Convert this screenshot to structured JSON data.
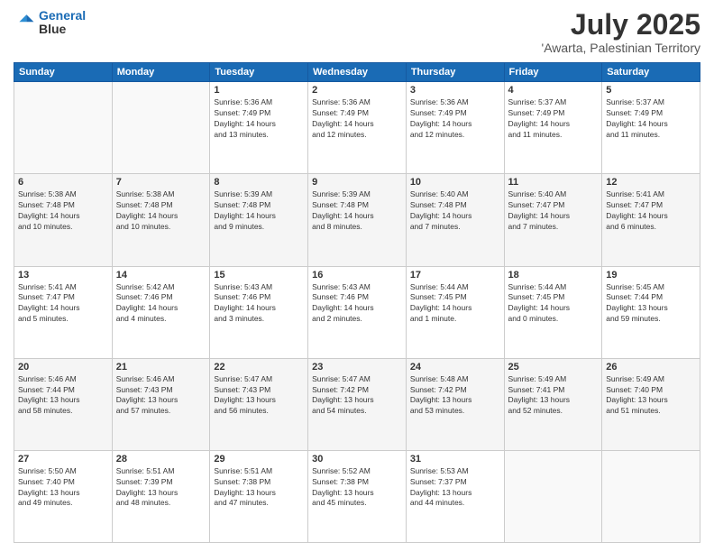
{
  "header": {
    "logo_line1": "General",
    "logo_line2": "Blue",
    "month": "July 2025",
    "location": "'Awarta, Palestinian Territory"
  },
  "weekdays": [
    "Sunday",
    "Monday",
    "Tuesday",
    "Wednesday",
    "Thursday",
    "Friday",
    "Saturday"
  ],
  "weeks": [
    [
      {
        "date": "",
        "info": ""
      },
      {
        "date": "",
        "info": ""
      },
      {
        "date": "1",
        "info": "Sunrise: 5:36 AM\nSunset: 7:49 PM\nDaylight: 14 hours\nand 13 minutes."
      },
      {
        "date": "2",
        "info": "Sunrise: 5:36 AM\nSunset: 7:49 PM\nDaylight: 14 hours\nand 12 minutes."
      },
      {
        "date": "3",
        "info": "Sunrise: 5:36 AM\nSunset: 7:49 PM\nDaylight: 14 hours\nand 12 minutes."
      },
      {
        "date": "4",
        "info": "Sunrise: 5:37 AM\nSunset: 7:49 PM\nDaylight: 14 hours\nand 11 minutes."
      },
      {
        "date": "5",
        "info": "Sunrise: 5:37 AM\nSunset: 7:49 PM\nDaylight: 14 hours\nand 11 minutes."
      }
    ],
    [
      {
        "date": "6",
        "info": "Sunrise: 5:38 AM\nSunset: 7:48 PM\nDaylight: 14 hours\nand 10 minutes."
      },
      {
        "date": "7",
        "info": "Sunrise: 5:38 AM\nSunset: 7:48 PM\nDaylight: 14 hours\nand 10 minutes."
      },
      {
        "date": "8",
        "info": "Sunrise: 5:39 AM\nSunset: 7:48 PM\nDaylight: 14 hours\nand 9 minutes."
      },
      {
        "date": "9",
        "info": "Sunrise: 5:39 AM\nSunset: 7:48 PM\nDaylight: 14 hours\nand 8 minutes."
      },
      {
        "date": "10",
        "info": "Sunrise: 5:40 AM\nSunset: 7:48 PM\nDaylight: 14 hours\nand 7 minutes."
      },
      {
        "date": "11",
        "info": "Sunrise: 5:40 AM\nSunset: 7:47 PM\nDaylight: 14 hours\nand 7 minutes."
      },
      {
        "date": "12",
        "info": "Sunrise: 5:41 AM\nSunset: 7:47 PM\nDaylight: 14 hours\nand 6 minutes."
      }
    ],
    [
      {
        "date": "13",
        "info": "Sunrise: 5:41 AM\nSunset: 7:47 PM\nDaylight: 14 hours\nand 5 minutes."
      },
      {
        "date": "14",
        "info": "Sunrise: 5:42 AM\nSunset: 7:46 PM\nDaylight: 14 hours\nand 4 minutes."
      },
      {
        "date": "15",
        "info": "Sunrise: 5:43 AM\nSunset: 7:46 PM\nDaylight: 14 hours\nand 3 minutes."
      },
      {
        "date": "16",
        "info": "Sunrise: 5:43 AM\nSunset: 7:46 PM\nDaylight: 14 hours\nand 2 minutes."
      },
      {
        "date": "17",
        "info": "Sunrise: 5:44 AM\nSunset: 7:45 PM\nDaylight: 14 hours\nand 1 minute."
      },
      {
        "date": "18",
        "info": "Sunrise: 5:44 AM\nSunset: 7:45 PM\nDaylight: 14 hours\nand 0 minutes."
      },
      {
        "date": "19",
        "info": "Sunrise: 5:45 AM\nSunset: 7:44 PM\nDaylight: 13 hours\nand 59 minutes."
      }
    ],
    [
      {
        "date": "20",
        "info": "Sunrise: 5:46 AM\nSunset: 7:44 PM\nDaylight: 13 hours\nand 58 minutes."
      },
      {
        "date": "21",
        "info": "Sunrise: 5:46 AM\nSunset: 7:43 PM\nDaylight: 13 hours\nand 57 minutes."
      },
      {
        "date": "22",
        "info": "Sunrise: 5:47 AM\nSunset: 7:43 PM\nDaylight: 13 hours\nand 56 minutes."
      },
      {
        "date": "23",
        "info": "Sunrise: 5:47 AM\nSunset: 7:42 PM\nDaylight: 13 hours\nand 54 minutes."
      },
      {
        "date": "24",
        "info": "Sunrise: 5:48 AM\nSunset: 7:42 PM\nDaylight: 13 hours\nand 53 minutes."
      },
      {
        "date": "25",
        "info": "Sunrise: 5:49 AM\nSunset: 7:41 PM\nDaylight: 13 hours\nand 52 minutes."
      },
      {
        "date": "26",
        "info": "Sunrise: 5:49 AM\nSunset: 7:40 PM\nDaylight: 13 hours\nand 51 minutes."
      }
    ],
    [
      {
        "date": "27",
        "info": "Sunrise: 5:50 AM\nSunset: 7:40 PM\nDaylight: 13 hours\nand 49 minutes."
      },
      {
        "date": "28",
        "info": "Sunrise: 5:51 AM\nSunset: 7:39 PM\nDaylight: 13 hours\nand 48 minutes."
      },
      {
        "date": "29",
        "info": "Sunrise: 5:51 AM\nSunset: 7:38 PM\nDaylight: 13 hours\nand 47 minutes."
      },
      {
        "date": "30",
        "info": "Sunrise: 5:52 AM\nSunset: 7:38 PM\nDaylight: 13 hours\nand 45 minutes."
      },
      {
        "date": "31",
        "info": "Sunrise: 5:53 AM\nSunset: 7:37 PM\nDaylight: 13 hours\nand 44 minutes."
      },
      {
        "date": "",
        "info": ""
      },
      {
        "date": "",
        "info": ""
      }
    ]
  ]
}
